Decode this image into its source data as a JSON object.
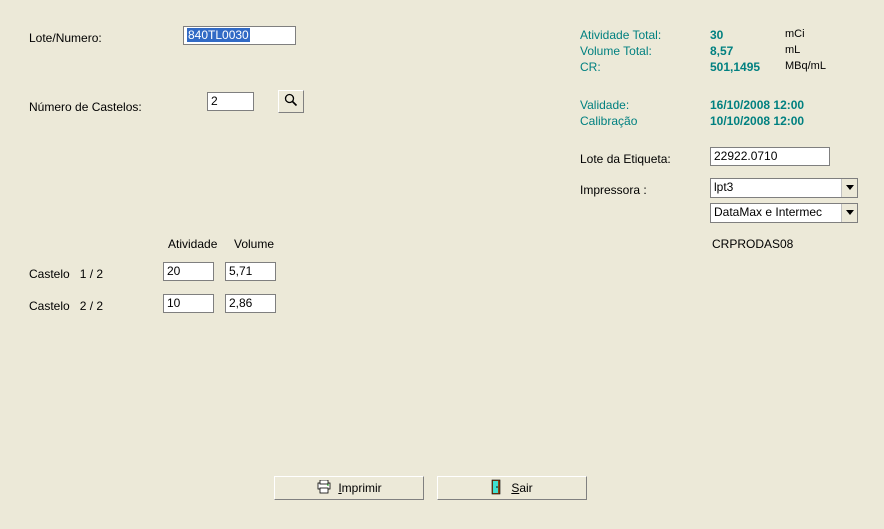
{
  "left": {
    "lote_numero_label": "Lote/Numero:",
    "lote_numero_value": "840TL0030",
    "numero_castelos_label": "Número de Castelos:",
    "numero_castelos_value": "2",
    "col_atividade": "Atividade",
    "col_volume": "Volume",
    "rows": [
      {
        "label": "Castelo   1 / 2",
        "atividade": "20",
        "volume": "5,71"
      },
      {
        "label": "Castelo   2 / 2",
        "atividade": "10",
        "volume": "2,86"
      }
    ]
  },
  "right": {
    "atividade_total_label": "Atividade Total:",
    "atividade_total_value": "30",
    "atividade_total_unit": "mCi",
    "volume_total_label": "Volume Total:",
    "volume_total_value": "8,57",
    "volume_total_unit": "mL",
    "cr_label": "CR:",
    "cr_value": "501,1495",
    "cr_unit": "MBq/mL",
    "validade_label": "Validade:",
    "validade_value": "16/10/2008 12:00",
    "calibracao_label": "Calibração",
    "calibracao_value": "10/10/2008 12:00",
    "lote_etiqueta_label": "Lote da Etiqueta:",
    "lote_etiqueta_value": "22922.0710",
    "impressora_label": "Impressora :",
    "impressora_value": "lpt3",
    "driver_value": "DataMax e Intermec",
    "host": "CRPRODAS08"
  },
  "buttons": {
    "imprimir_prefix": "I",
    "imprimir_rest": "mprimir",
    "sair_prefix": "S",
    "sair_rest": "air"
  }
}
